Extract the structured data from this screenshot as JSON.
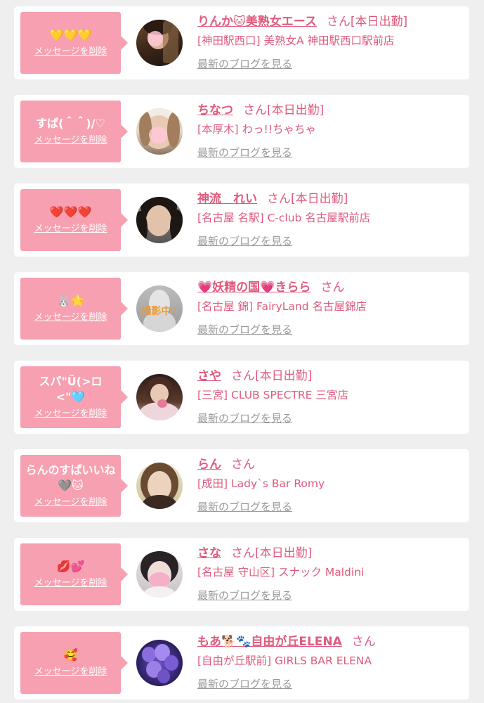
{
  "delete_label": "メッセージを削除",
  "san_label": "さん",
  "blog_label": "最新のブログを見る",
  "colors": {
    "background": "#efefef",
    "card": "#ffffff",
    "message_box": "#f7a0b1",
    "accent_text": "#e05a7d",
    "link_gray": "#999999"
  },
  "cards": [
    {
      "message": "💛💛💛",
      "name": "りんか🐱美熟女エース",
      "status": "[本日出勤]",
      "shop": "[神田駅西口] 美熟女A 神田駅西口駅前店",
      "avatar_icon": "woman-photo"
    },
    {
      "message": "すぱ(＾＾)/♡",
      "name": "ちなつ",
      "status": "[本日出勤]",
      "shop": "[本厚木] わっ!!ちゃちゃ",
      "avatar_icon": "woman-photo"
    },
    {
      "message": "❤️❤️❤️",
      "name": "神流　れい",
      "status": "[本日出勤]",
      "shop": "[名古屋 名駅] C-club 名古屋駅前店",
      "avatar_icon": "woman-photo"
    },
    {
      "message": "🐰🌟",
      "name": "💗妖精の国💗きらら",
      "status": "",
      "shop": "[名古屋 錦] FairyLand 名古屋錦店",
      "avatar_icon": "woman-photo",
      "avatar_overlay": "撮影中♪"
    },
    {
      "message": "スパ\"Ü(>ロ<\"🩵",
      "name": "さや",
      "status": "[本日出勤]",
      "shop": "[三宮] CLUB SPECTRE 三宮店",
      "avatar_icon": "woman-photo"
    },
    {
      "message": "らんのすぱいいね🩶🐱",
      "name": "らん",
      "status": "",
      "shop": "[成田] Lady`s Bar Romy",
      "avatar_icon": "woman-photo"
    },
    {
      "message": "💋💕",
      "name": "さな",
      "status": "[本日出勤]",
      "shop": "[名古屋 守山区] スナック Maldini",
      "avatar_icon": "woman-photo"
    },
    {
      "message": "🥰",
      "name": "もあ🐕🐾自由が丘ELENA",
      "status": "",
      "shop": "[自由が丘駅前] GIRLS BAR ELENA",
      "avatar_icon": "balloons-photo"
    }
  ]
}
